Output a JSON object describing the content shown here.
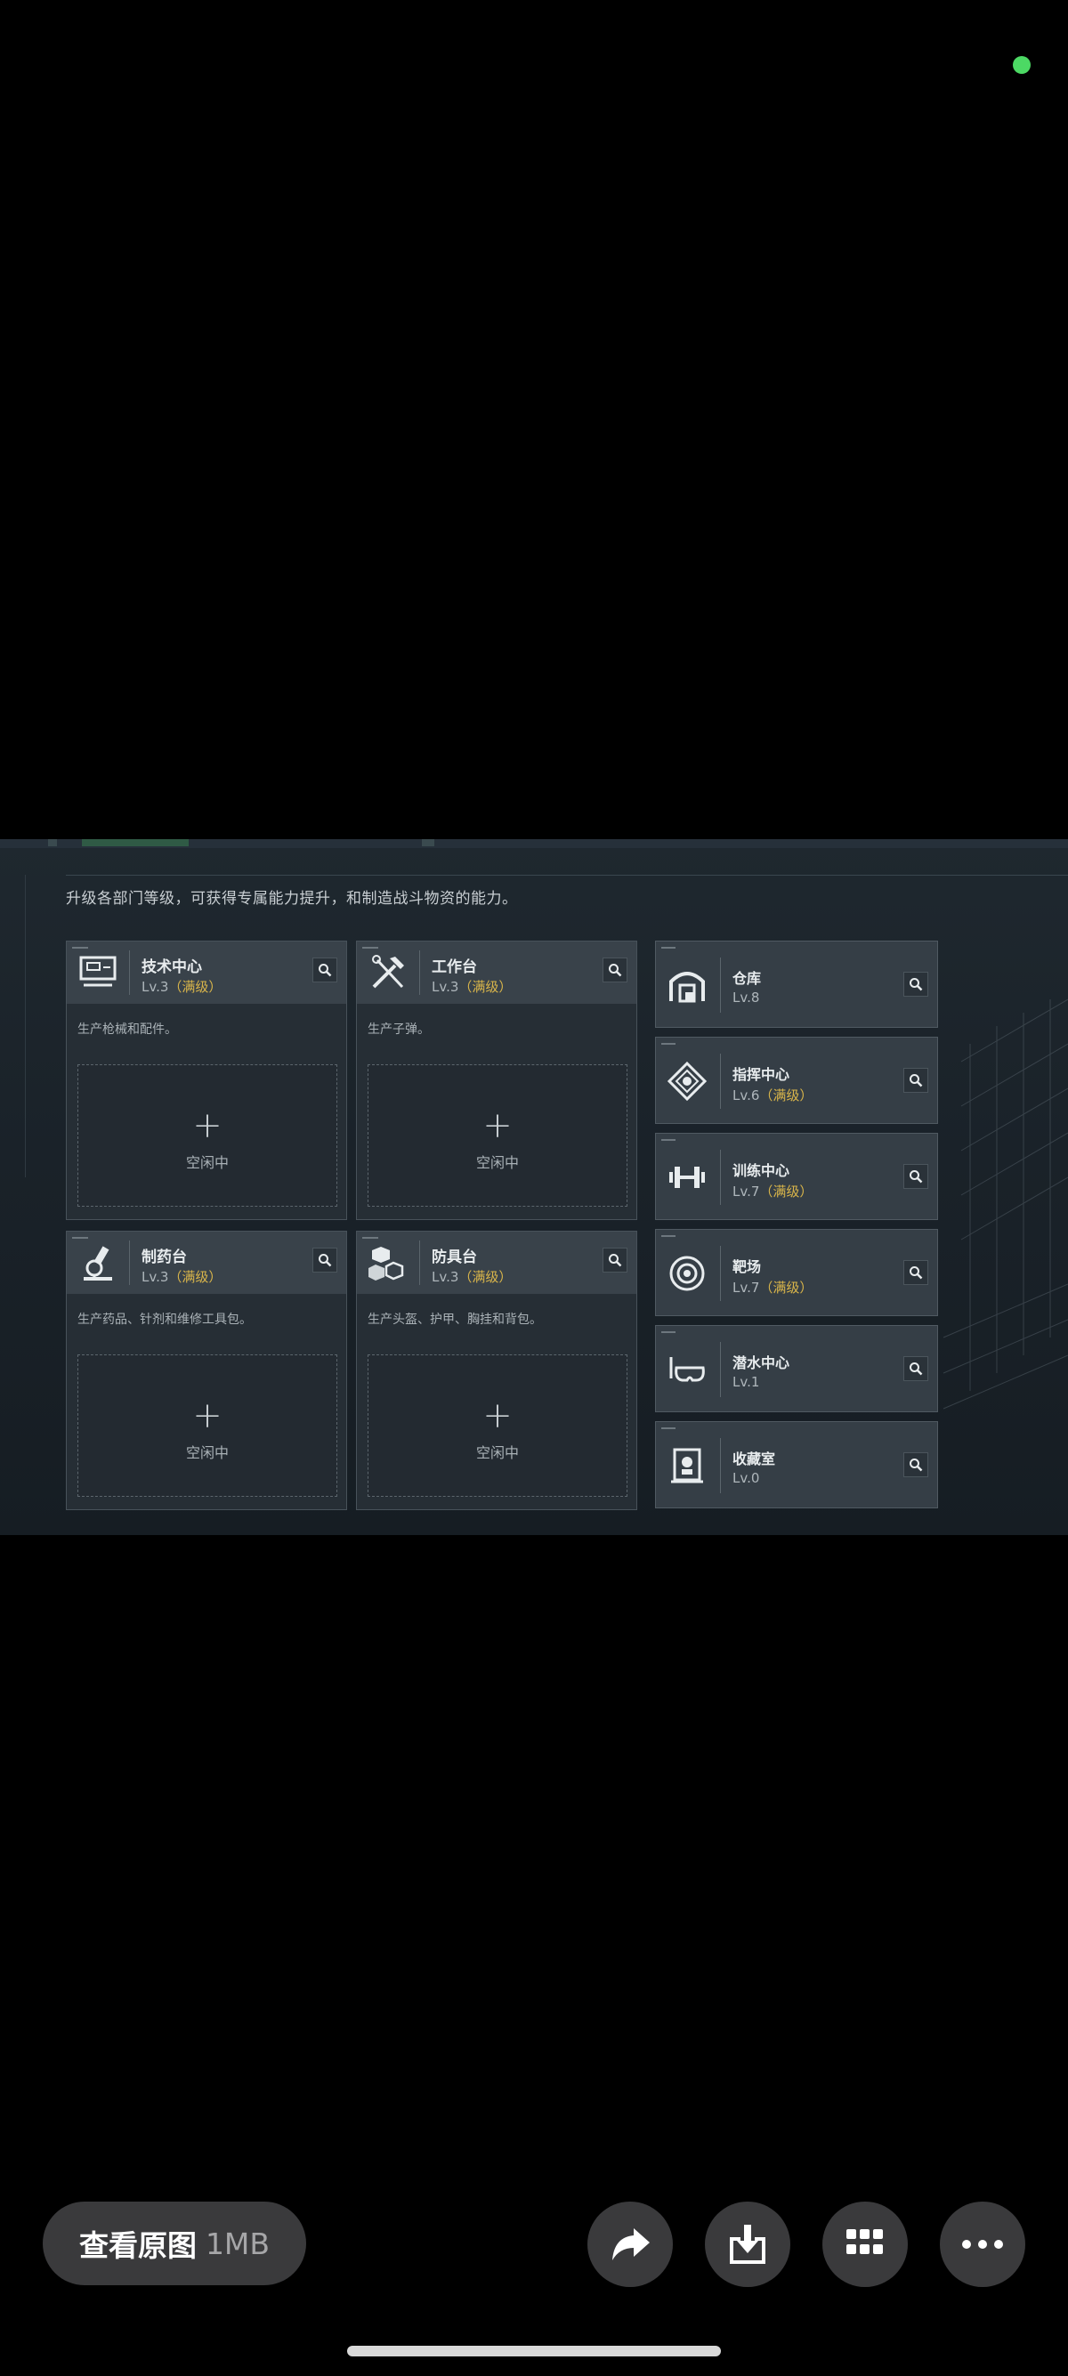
{
  "game": {
    "description": "升级各部门等级，可获得专属能力提升，和制造战斗物资的能力。",
    "workshops": [
      {
        "name": "技术中心",
        "lv": "Lv.3",
        "max": "（满级）",
        "produce": "生产枪械和配件。",
        "slot_label": "空闲中",
        "icon": "computer-icon"
      },
      {
        "name": "工作台",
        "lv": "Lv.3",
        "max": "（满级）",
        "produce": "生产子弹。",
        "slot_label": "空闲中",
        "icon": "tools-icon"
      },
      {
        "name": "制药台",
        "lv": "Lv.3",
        "max": "（满级）",
        "produce": "生产药品、针剂和维修工具包。",
        "slot_label": "空闲中",
        "icon": "microscope-icon"
      },
      {
        "name": "防具台",
        "lv": "Lv.3",
        "max": "（满级）",
        "produce": "生产头盔、护甲、胸挂和背包。",
        "slot_label": "空闲中",
        "icon": "armor-icon"
      }
    ],
    "facilities": [
      {
        "name": "仓库",
        "lv": "Lv.8",
        "max": "",
        "icon": "warehouse-icon"
      },
      {
        "name": "指挥中心",
        "lv": "Lv.6",
        "max": "（满级）",
        "icon": "command-icon"
      },
      {
        "name": "训练中心",
        "lv": "Lv.7",
        "max": "（满级）",
        "icon": "dumbbell-icon"
      },
      {
        "name": "靶场",
        "lv": "Lv.7",
        "max": "（满级）",
        "icon": "target-icon"
      },
      {
        "name": "潜水中心",
        "lv": "Lv.1",
        "max": "",
        "icon": "diving-mask-icon"
      },
      {
        "name": "收藏室",
        "lv": "Lv.0",
        "max": "",
        "icon": "collection-icon"
      }
    ]
  },
  "viewer": {
    "view_original_label": "查看原图",
    "file_size": "1MB",
    "actions": [
      "share-icon",
      "download-icon",
      "grid-icon",
      "more-icon"
    ]
  },
  "colors": {
    "max_level": "#d9b54a",
    "status_dot": "#4cd964"
  }
}
